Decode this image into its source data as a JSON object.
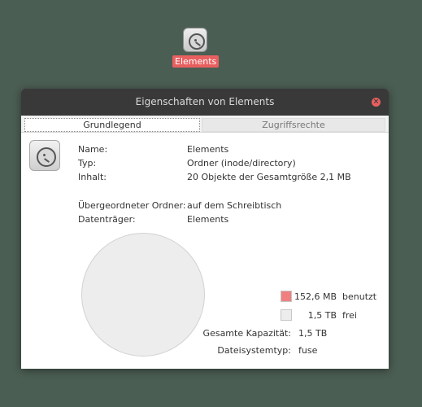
{
  "desktop": {
    "icon_label": "Elements"
  },
  "window": {
    "title": "Eigenschaften von Elements",
    "close_symbol": "×",
    "tabs": [
      {
        "label": "Grundlegend",
        "active": true
      },
      {
        "label": "Zugriffsrechte",
        "active": false
      }
    ]
  },
  "info": {
    "name_label": "Name:",
    "name_value": "Elements",
    "type_label": "Typ:",
    "type_value": "Ordner (inode/directory)",
    "content_label": "Inhalt:",
    "content_value": "20 Objekte der Gesamtgröße 2,1 MB",
    "parent_label": "Übergeordneter Ordner:",
    "parent_value": "auf dem Schreibtisch",
    "volume_label": "Datenträger:",
    "volume_value": "Elements"
  },
  "usage": {
    "used_value": "152,6 MB",
    "used_label": "benutzt",
    "used_color": "#f08080",
    "free_value": "1,5 TB",
    "free_label": "frei",
    "free_color": "#ededed",
    "capacity_label": "Gesamte Kapazität:",
    "capacity_value": "1,5 TB",
    "fs_label": "Dateisystemtyp:",
    "fs_value": "fuse"
  },
  "icons": {
    "desktop_icon": "drive-harddisk-icon",
    "file_icon": "drive-harddisk-icon",
    "close": "close-icon"
  },
  "colors": {
    "background": "#4b5e53",
    "accent": "#e95f5f",
    "titlebar": "#393939"
  }
}
